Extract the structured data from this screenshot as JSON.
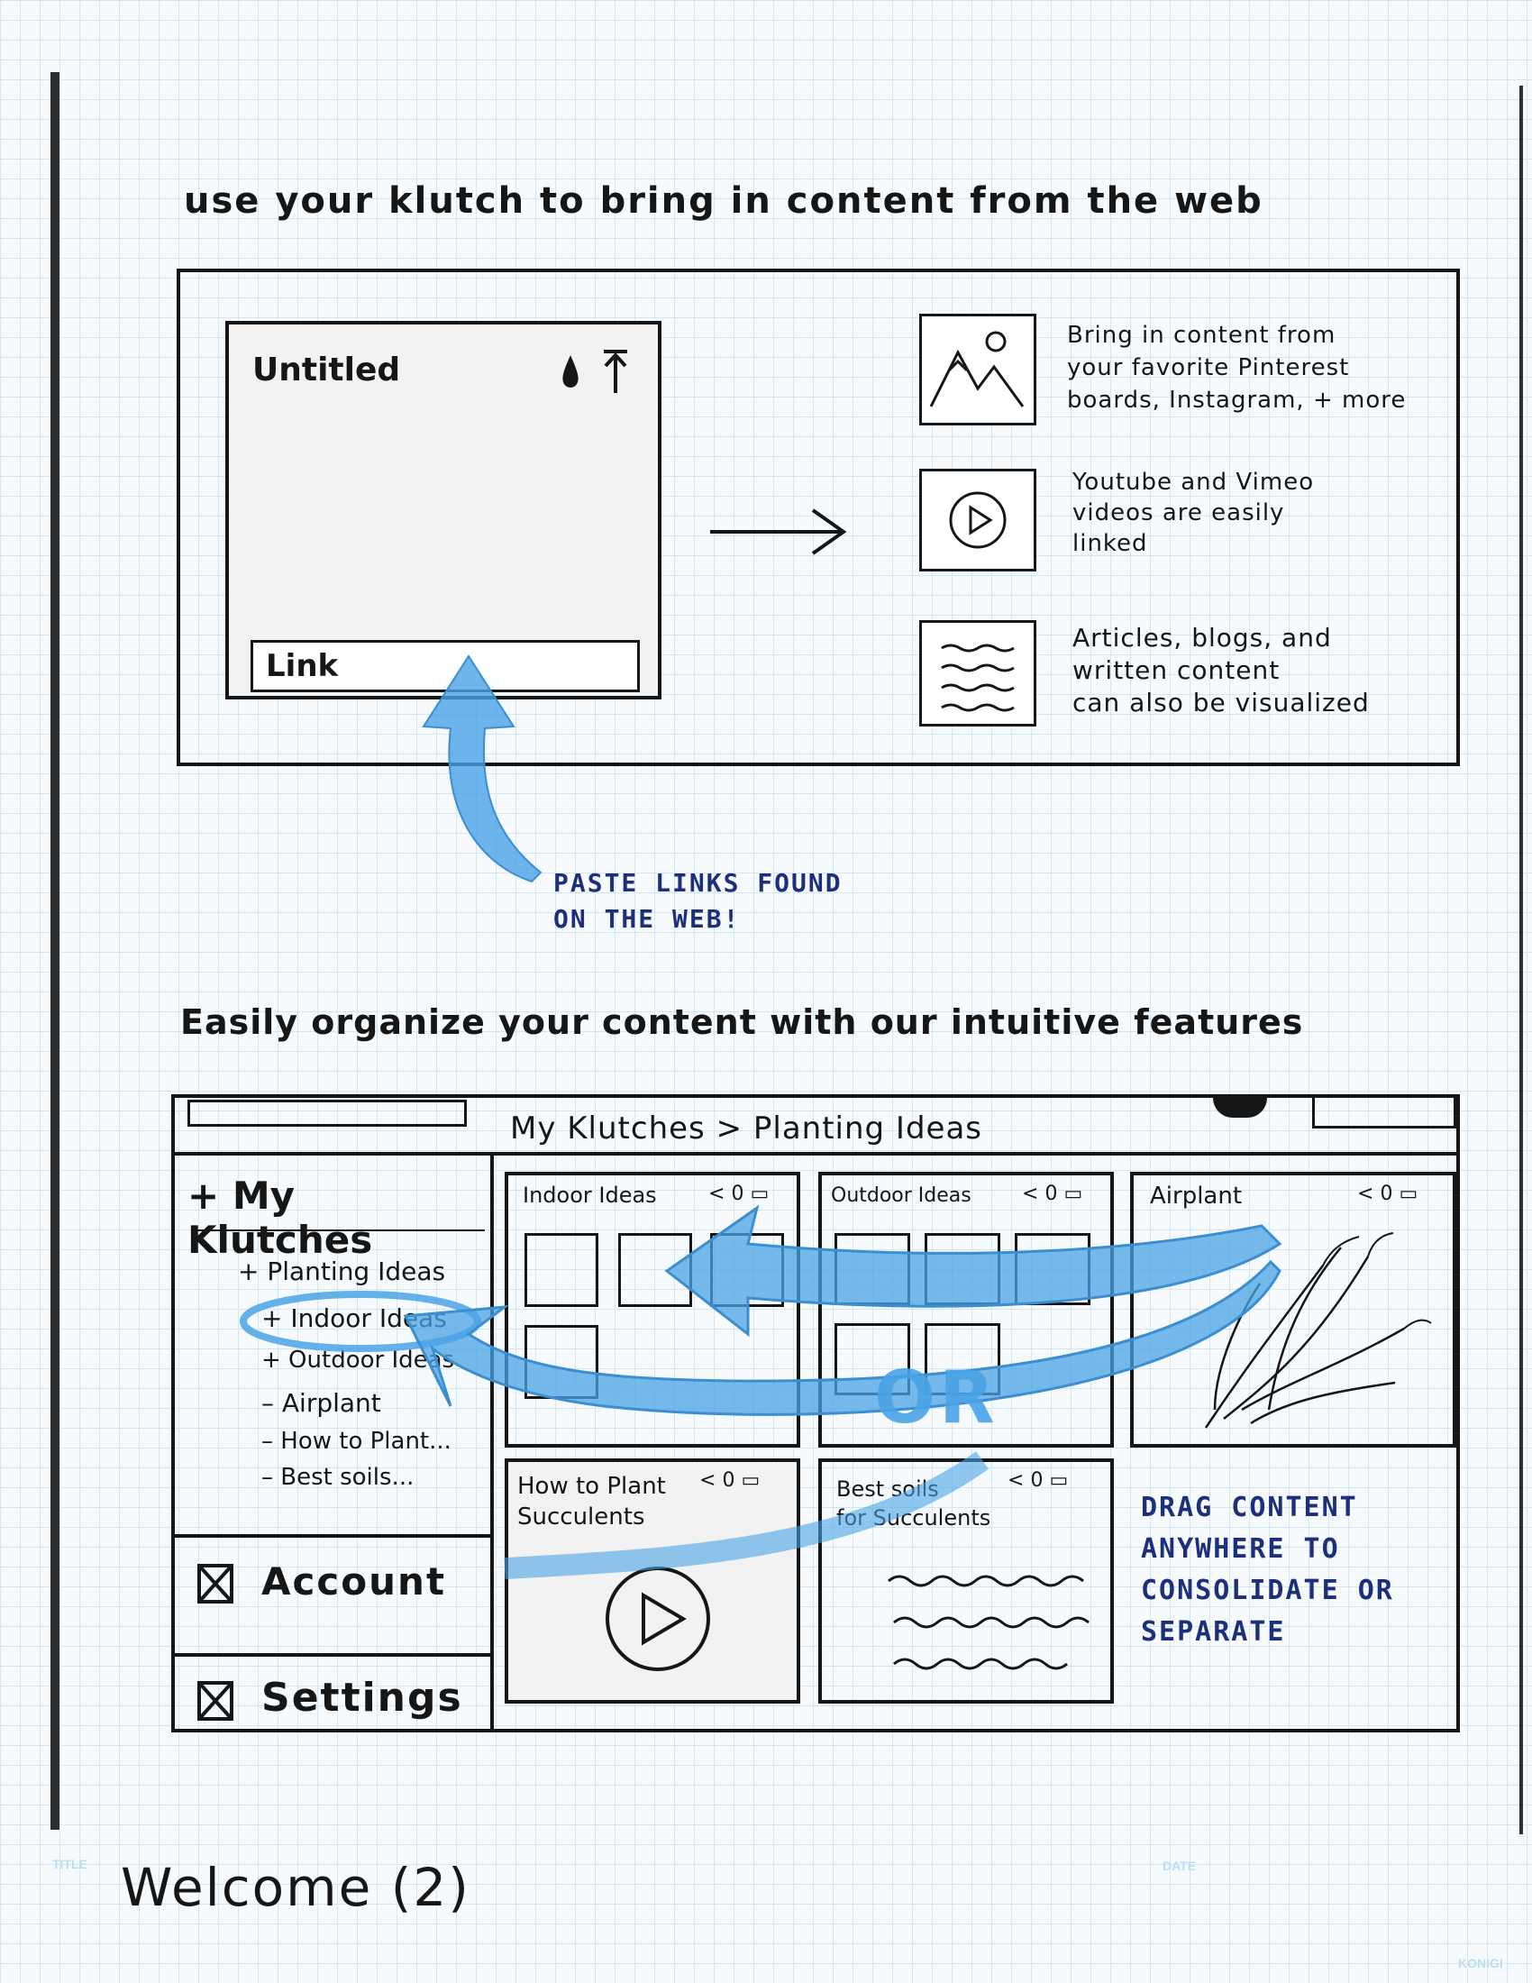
{
  "heading1": "use your klutch to bring in content from the web",
  "editor": {
    "title": "Untitled",
    "link_field": "Link"
  },
  "sources": [
    {
      "icon": "image-icon",
      "text_lines": [
        "Bring in content from",
        "your favorite Pinterest",
        "boards, Instagram, + more"
      ]
    },
    {
      "icon": "video-play-icon",
      "text_lines": [
        "Youtube and Vimeo",
        "videos are easily",
        "linked"
      ]
    },
    {
      "icon": "article-icon",
      "text_lines": [
        "Articles, blogs, and",
        "written content",
        "can also be visualized"
      ]
    }
  ],
  "paste_note": [
    "PASTE LINKS FOUND",
    "ON THE WEB!"
  ],
  "heading2": "Easily organize your content with our intuitive features",
  "app": {
    "breadcrumb": "My Klutches > Planting Ideas",
    "sidebar": {
      "header": "+ My Klutches",
      "items": [
        "+ Planting Ideas",
        "+ Indoor Ideas",
        "+ Outdoor Ideas",
        "– Airplant",
        "– How to Plant...",
        "– Best soils..."
      ],
      "account": "Account",
      "settings": "Settings"
    },
    "cards": [
      {
        "title": "Indoor Ideas",
        "counts": "0"
      },
      {
        "title": "Outdoor Ideas",
        "counts": "0"
      },
      {
        "title": "Airplant",
        "counts": "0"
      },
      {
        "title": "How to Plant\nSucculents",
        "counts": "0"
      },
      {
        "title": "Best soils\nfor Succulents",
        "counts": "0"
      }
    ],
    "or_label": "OR",
    "drag_note": [
      "DRAG CONTENT",
      "ANYWHERE TO",
      "CONSOLIDATE OR",
      "SEPARATE"
    ]
  },
  "footer": {
    "title_label": "TITLE",
    "title_value": "Welcome (2)",
    "date_label": "DATE",
    "brand": "KONIGI"
  },
  "colors": {
    "ink": "#161616",
    "blue_marker": "#4aa3e6",
    "blue_ink": "#1b2f7a",
    "grid": "#d4e6f1"
  }
}
